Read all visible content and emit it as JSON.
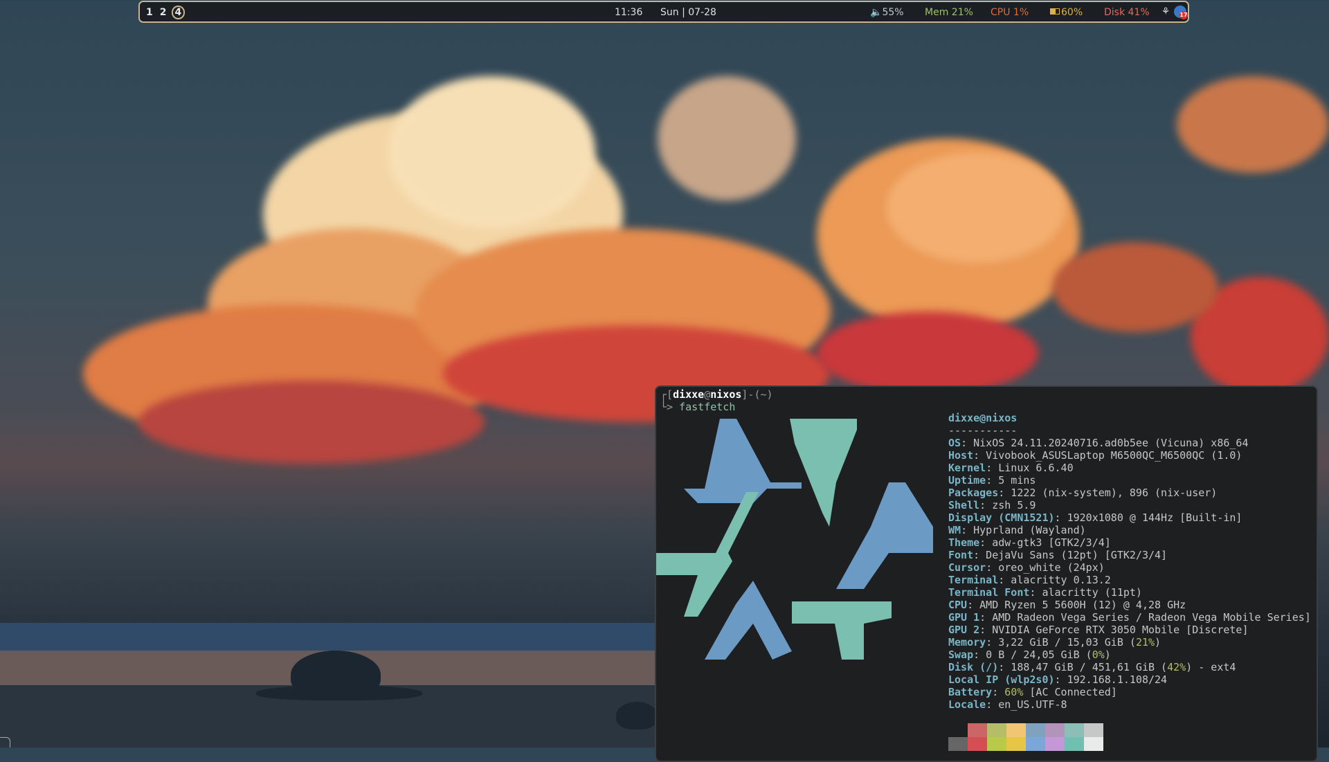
{
  "topbar": {
    "workspaces": [
      {
        "label": "1",
        "active": false
      },
      {
        "label": "2",
        "active": false
      },
      {
        "label": "4",
        "active": true
      }
    ],
    "clock": "11:36",
    "date": "Sun | 07-28",
    "volume": "55%",
    "memory": "Mem 21%",
    "cpu": "CPU  1%",
    "battery": "60%",
    "disk": "Disk 41%",
    "notification_count": "17",
    "colors": {
      "border": "#c9b58a",
      "mem": "#9ec26a",
      "cpu": "#e06c3a",
      "battery": "#e0b040",
      "disk": "#e06c5a"
    },
    "icons": [
      "volume-icon",
      "battery-icon",
      "wifi-icon",
      "notification-icon"
    ]
  },
  "terminal": {
    "prompt_user": "dixxe",
    "prompt_at": "@",
    "prompt_host": "nixos",
    "prompt_dir": "(~)",
    "prompt_arrow": "> ",
    "command": "fastfetch",
    "title": "dixxe@nixos",
    "separator": "-----------",
    "info": [
      {
        "key": "OS",
        "value": " NixOS 24.11.20240716.ad0b5ee (Vicuna) x86_64"
      },
      {
        "key": "Host",
        "value": " Vivobook_ASUSLaptop M6500QC_M6500QC (1.0)"
      },
      {
        "key": "Kernel",
        "value": " Linux 6.6.40"
      },
      {
        "key": "Uptime",
        "value": " 5 mins"
      },
      {
        "key": "Packages",
        "value": " 1222 (nix-system), 896 (nix-user)"
      },
      {
        "key": "Shell",
        "value": " zsh 5.9"
      },
      {
        "key": "Display (CMN1521)",
        "value": " 1920x1080 @ 144Hz [Built-in]"
      },
      {
        "key": "WM",
        "value": " Hyprland (Wayland)"
      },
      {
        "key": "Theme",
        "value": " adw-gtk3 [GTK2/3/4]"
      },
      {
        "key": "Font",
        "value": " DejaVu Sans (12pt) [GTK2/3/4]"
      },
      {
        "key": "Cursor",
        "value": " oreo_white (24px)"
      },
      {
        "key": "Terminal",
        "value": " alacritty 0.13.2"
      },
      {
        "key": "Terminal Font",
        "value": " alacritty (11pt)"
      },
      {
        "key": "CPU",
        "value": " AMD Ryzen 5 5600H (12) @ 4,28 GHz"
      },
      {
        "key": "GPU 1",
        "value": " AMD Radeon Vega Series / Radeon Vega Mobile Series]"
      },
      {
        "key": "GPU 2",
        "value": " NVIDIA GeForce RTX 3050 Mobile [Discrete]"
      },
      {
        "key": "Memory",
        "value": " 3,22 GiB / 15,03 GiB (",
        "pct": "21%",
        "after": ")"
      },
      {
        "key": "Swap",
        "value": " 0 B / 24,05 GiB (",
        "pct": "0%",
        "after": ")"
      },
      {
        "key": "Disk (/)",
        "value": " 188,47 GiB / 451,61 GiB (",
        "pct": "42%",
        "after": ") - ext4"
      },
      {
        "key": "Local IP (wlp2s0)",
        "value": " 192.168.1.108/24"
      },
      {
        "key": "Battery",
        "value": " ",
        "pct": "60%",
        "after": " [AC Connected]"
      },
      {
        "key": "Locale",
        "value": " en_US.UTF-8"
      }
    ],
    "palette_top": [
      "#1d1f21",
      "#cc6666",
      "#b5bd68",
      "#f0c674",
      "#81a2be",
      "#b294bb",
      "#8abeb7",
      "#c5c8c6"
    ],
    "palette_bottom": [
      "#666666",
      "#d54e53",
      "#b9ca4a",
      "#e7c547",
      "#7aa6da",
      "#c397d8",
      "#70c0b1",
      "#eaeaea"
    ],
    "logo_colors": {
      "blue": "#6b9ac4",
      "teal": "#7bbfb0"
    }
  }
}
